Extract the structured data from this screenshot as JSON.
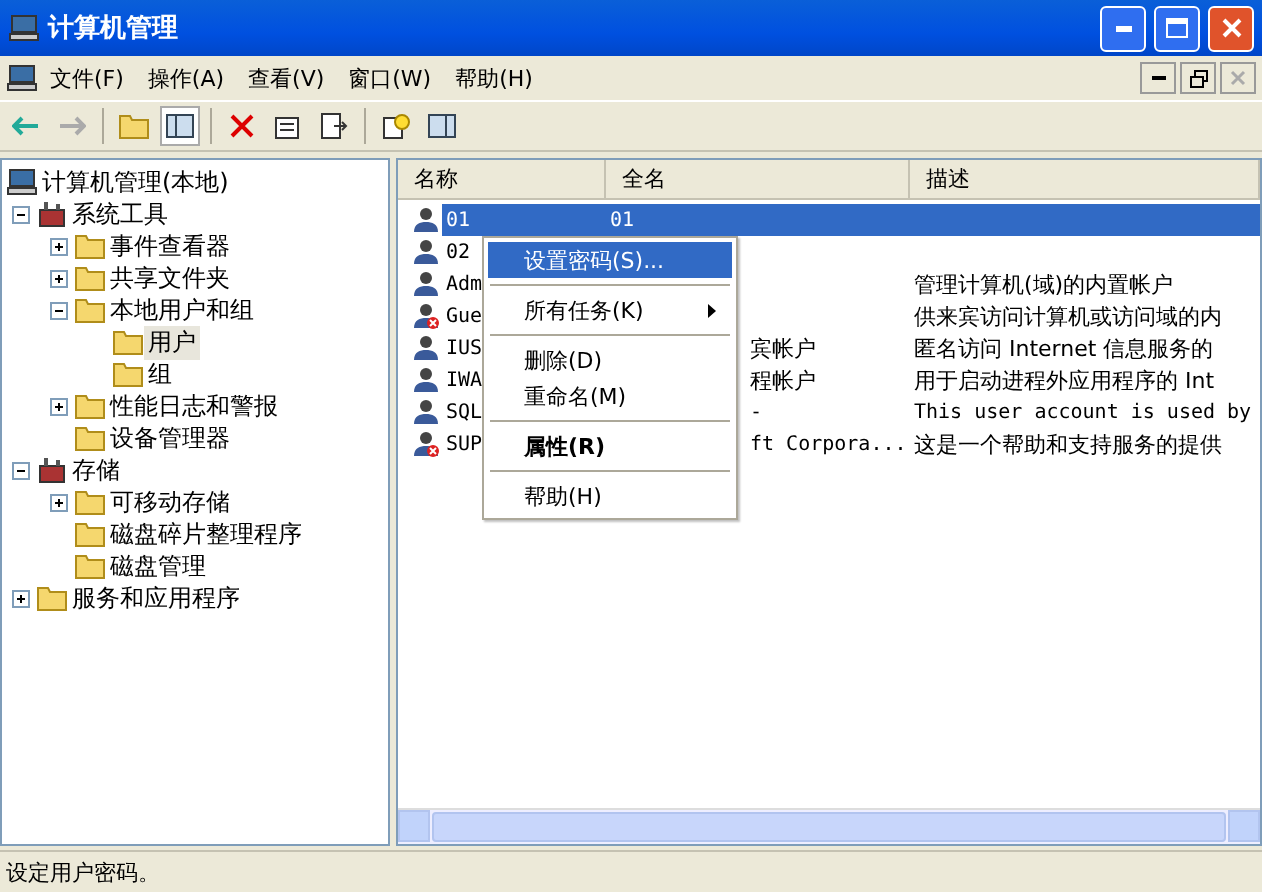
{
  "window": {
    "title": "计算机管理"
  },
  "menu_bar": [
    "文件(F)",
    "操作(A)",
    "查看(V)",
    "窗口(W)",
    "帮助(H)"
  ],
  "tree": [
    {
      "label": "计算机管理(本地)",
      "selected": false,
      "children": [
        {
          "label": "系统工具",
          "expanded": true,
          "selected": false,
          "children": [
            {
              "label": "事件查看器",
              "expanded": false,
              "selected": false
            },
            {
              "label": "共享文件夹",
              "expanded": false,
              "selected": false
            },
            {
              "label": "本地用户和组",
              "expanded": true,
              "selected": false,
              "children": [
                {
                  "label": "用户",
                  "selected": true
                },
                {
                  "label": "组",
                  "selected": false
                }
              ]
            },
            {
              "label": "性能日志和警报",
              "expanded": false,
              "selected": false
            },
            {
              "label": "设备管理器",
              "selected": false
            }
          ]
        },
        {
          "label": "存储",
          "expanded": true,
          "selected": false,
          "children": [
            {
              "label": "可移动存储",
              "expanded": false,
              "selected": false
            },
            {
              "label": "磁盘碎片整理程序",
              "selected": false
            },
            {
              "label": "磁盘管理",
              "selected": false
            }
          ]
        },
        {
          "label": "服务和应用程序",
          "expanded": false,
          "selected": false
        }
      ]
    }
  ],
  "table": {
    "columns": [
      "名称",
      "全名",
      "描述"
    ],
    "rows": [
      {
        "name": "01",
        "full_name": "01",
        "selected": true,
        "disabled": false
      },
      {
        "name": "02",
        "selected": false,
        "disabled": false
      },
      {
        "name": "Adm",
        "description": "管理计算机(域)的内置帐户",
        "selected": false,
        "disabled": false
      },
      {
        "name": "Gue",
        "description": "供来宾访问计算机或访问域的内",
        "selected": false,
        "disabled": true
      },
      {
        "name": "IUS",
        "full_name": "宾帐户",
        "description": "匿名访问 Internet 信息服务的",
        "selected": false,
        "disabled": false
      },
      {
        "name": "IWA",
        "full_name": "程帐户",
        "description": "用于启动进程外应用程序的 Int",
        "selected": false,
        "disabled": false
      },
      {
        "name": "SQL",
        "full_name": "-",
        "description": "This user account is used by",
        "selected": false,
        "disabled": false
      },
      {
        "name": "SUP",
        "full_name": "ft Corpora...",
        "description": "这是一个帮助和支持服务的提供",
        "selected": false,
        "disabled": true
      }
    ]
  },
  "context_menu": [
    {
      "label": "设置密码(S)...",
      "selected": true,
      "bold": false,
      "submenu": false,
      "separator_after": true
    },
    {
      "label": "所有任务(K)",
      "selected": false,
      "bold": false,
      "submenu": true,
      "separator_after": true
    },
    {
      "label": "删除(D)",
      "selected": false,
      "bold": false,
      "submenu": false,
      "separator_after": false
    },
    {
      "label": "重命名(M)",
      "selected": false,
      "bold": false,
      "submenu": false,
      "separator_after": true
    },
    {
      "label": "属性(R)",
      "selected": false,
      "bold": true,
      "submenu": false,
      "separator_after": true
    },
    {
      "label": "帮助(H)",
      "selected": false,
      "bold": false,
      "submenu": false,
      "separator_after": false
    }
  ],
  "status_bar": "设定用户密码。"
}
